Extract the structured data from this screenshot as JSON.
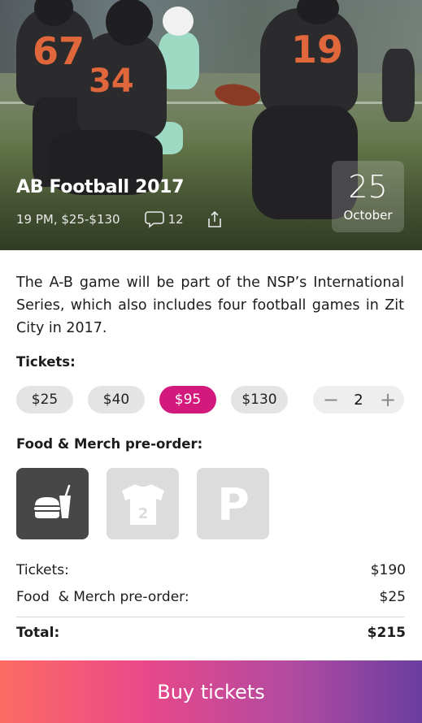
{
  "event": {
    "title": "AB Football 2017",
    "meta": "19 PM, $25-$130",
    "comment_count": "12",
    "date_day": "25",
    "date_month": "October"
  },
  "description": "The A-B game will be part of the NSP’s International Series, which also includes four football games in Zit City in 2017.",
  "tickets": {
    "label": "Tickets:",
    "options": [
      "$25",
      "$40",
      "$95",
      "$130"
    ],
    "selected_index": 2,
    "quantity": "2"
  },
  "merch": {
    "label": "Food & Merch pre-order:",
    "items": [
      {
        "icon": "burger-drink-icon",
        "active": true
      },
      {
        "icon": "jersey-icon",
        "jersey_number": "2",
        "active": false
      },
      {
        "icon": "parking-icon",
        "letter": "P",
        "active": false
      }
    ]
  },
  "summary": {
    "tickets_label": "Tickets:",
    "tickets_value": "$190",
    "merch_label": "Food  & Merch pre-order:",
    "merch_value": "$25",
    "total_label": "Total:",
    "total_value": "$215"
  },
  "buy_label": "Buy tickets",
  "colors": {
    "accent": "#d4197d",
    "chip": "#e4e4e4",
    "tile_active": "#474747",
    "tile_inactive": "#dcdcdc"
  }
}
